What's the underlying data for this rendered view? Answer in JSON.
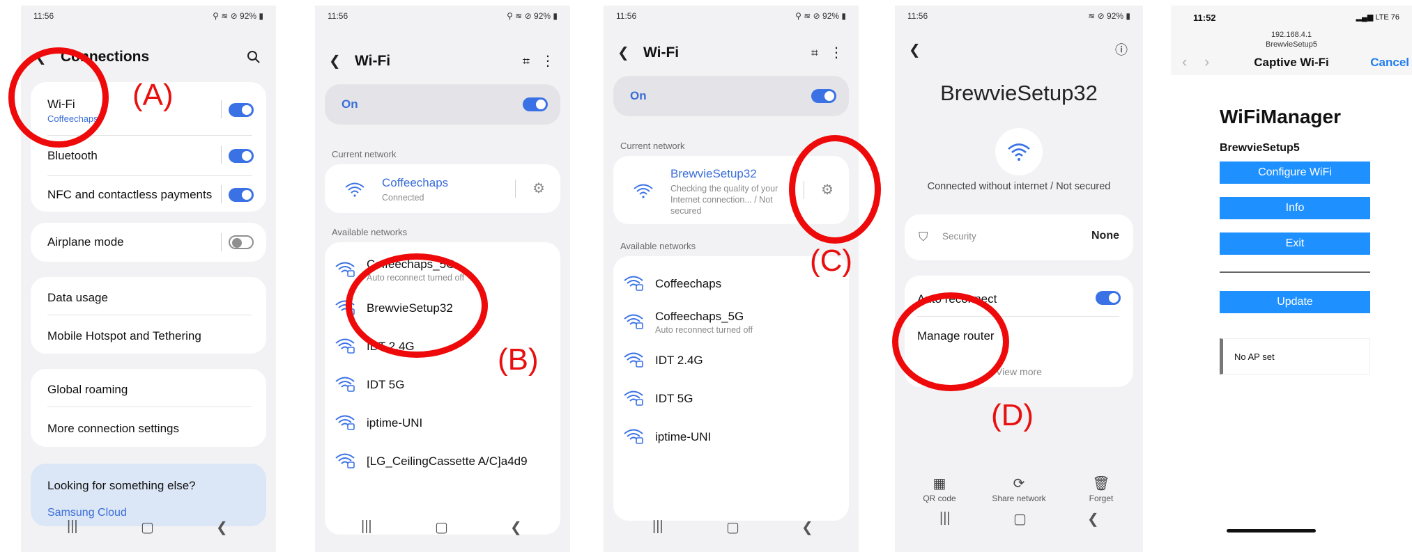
{
  "screen1": {
    "status_time": "11:56",
    "status_right": "92%",
    "title": "Connections",
    "wifi_label": "Wi-Fi",
    "wifi_network": "Coffeechaps",
    "bluetooth_label": "Bluetooth",
    "nfc_label": "NFC and contactless payments",
    "airplane_label": "Airplane mode",
    "data_usage_label": "Data usage",
    "hotspot_label": "Mobile Hotspot and Tethering",
    "roaming_label": "Global roaming",
    "more_label": "More connection settings",
    "looking_label": "Looking for something else?",
    "samsung_cloud_link": "Samsung Cloud",
    "annotation": "(A)"
  },
  "screen2": {
    "status_time": "11:56",
    "status_right": "92%",
    "title": "Wi-Fi",
    "on_label": "On",
    "current_network_label": "Current network",
    "current_name": "Coffeechaps",
    "current_status": "Connected",
    "available_label": "Available networks",
    "networks": [
      {
        "name": "Coffeechaps_5G",
        "sub": "Auto reconnect turned off"
      },
      {
        "name": "BrewvieSetup32",
        "sub": ""
      },
      {
        "name": "IDT 2.4G",
        "sub": ""
      },
      {
        "name": "IDT 5G",
        "sub": ""
      },
      {
        "name": "iptime-UNI",
        "sub": ""
      },
      {
        "name": "[LG_CeilingCassette A/C]a4d9",
        "sub": ""
      }
    ],
    "annotation": "(B)"
  },
  "screen3": {
    "status_time": "11:56",
    "status_right": "92%",
    "title": "Wi-Fi",
    "on_label": "On",
    "current_network_label": "Current network",
    "current_name": "BrewvieSetup32",
    "current_status": "Checking the quality of your Internet connection... / Not secured",
    "available_label": "Available networks",
    "networks": [
      {
        "name": "Coffeechaps",
        "sub": ""
      },
      {
        "name": "Coffeechaps_5G",
        "sub": "Auto reconnect turned off"
      },
      {
        "name": "IDT 2.4G",
        "sub": ""
      },
      {
        "name": "IDT 5G",
        "sub": ""
      },
      {
        "name": "iptime-UNI",
        "sub": ""
      }
    ],
    "annotation": "(C)"
  },
  "screen4": {
    "status_time": "11:56",
    "status_right": "92%",
    "network_name": "BrewvieSetup32",
    "connection_status": "Connected without internet / Not secured",
    "security_label": "Security",
    "security_value": "None",
    "auto_reconnect_label": "Auto reconnect",
    "manage_router_label": "Manage router",
    "view_more_label": "View more",
    "qr_label": "QR code",
    "share_label": "Share network",
    "forget_label": "Forget",
    "annotation": "(D)"
  },
  "screen5": {
    "status_time": "11:52",
    "status_right": "LTE 76",
    "url_ip": "192.168.4.1",
    "url_name": "BrewvieSetup5",
    "nav_title": "Captive Wi-Fi",
    "cancel_label": "Cancel",
    "page_heading": "WiFiManager",
    "ssid_label": "BrewvieSetup5",
    "configure_btn": "Configure WiFi",
    "info_btn": "Info",
    "exit_btn": "Exit",
    "update_btn": "Update",
    "status_box": "No AP set"
  },
  "colors": {
    "accent_blue": "#3a72e6",
    "annotation_red": "#ee0a0a",
    "wm_button_blue": "#1e90ff"
  }
}
